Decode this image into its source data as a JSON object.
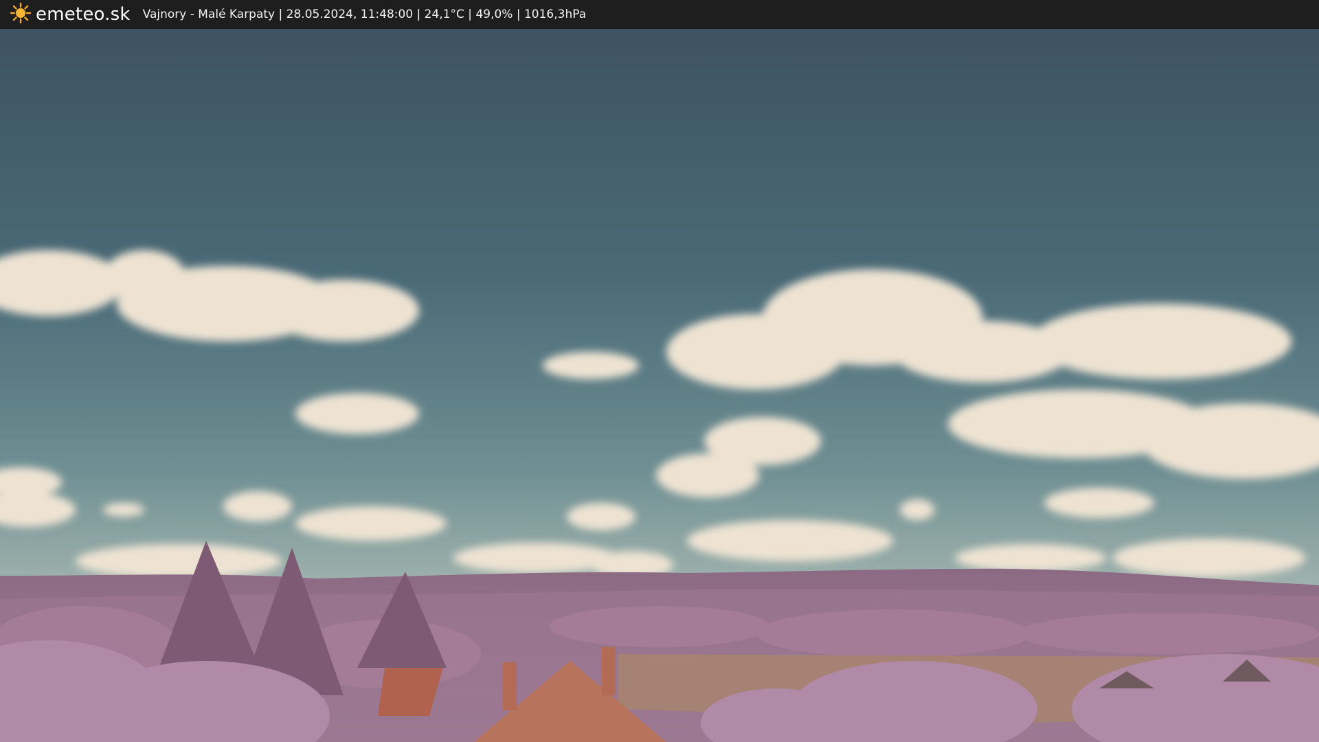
{
  "header": {
    "brand": "emeteo.sk",
    "logo_icon": "sun-icon",
    "caption": "Vajnory - Malé Karpaty | 28.05.2024, 11:48:00 | 24,1°C | 49,0% | 1016,3hPa"
  },
  "colors": {
    "bar_background": "#1e1e1e",
    "sun_accent": "#f5a623",
    "sky_top": "#3f5563",
    "sky_horizon": "#8aa6a8",
    "cloud": "#eee3d3",
    "foliage": "#a57a96",
    "roof": "#b0624e"
  }
}
